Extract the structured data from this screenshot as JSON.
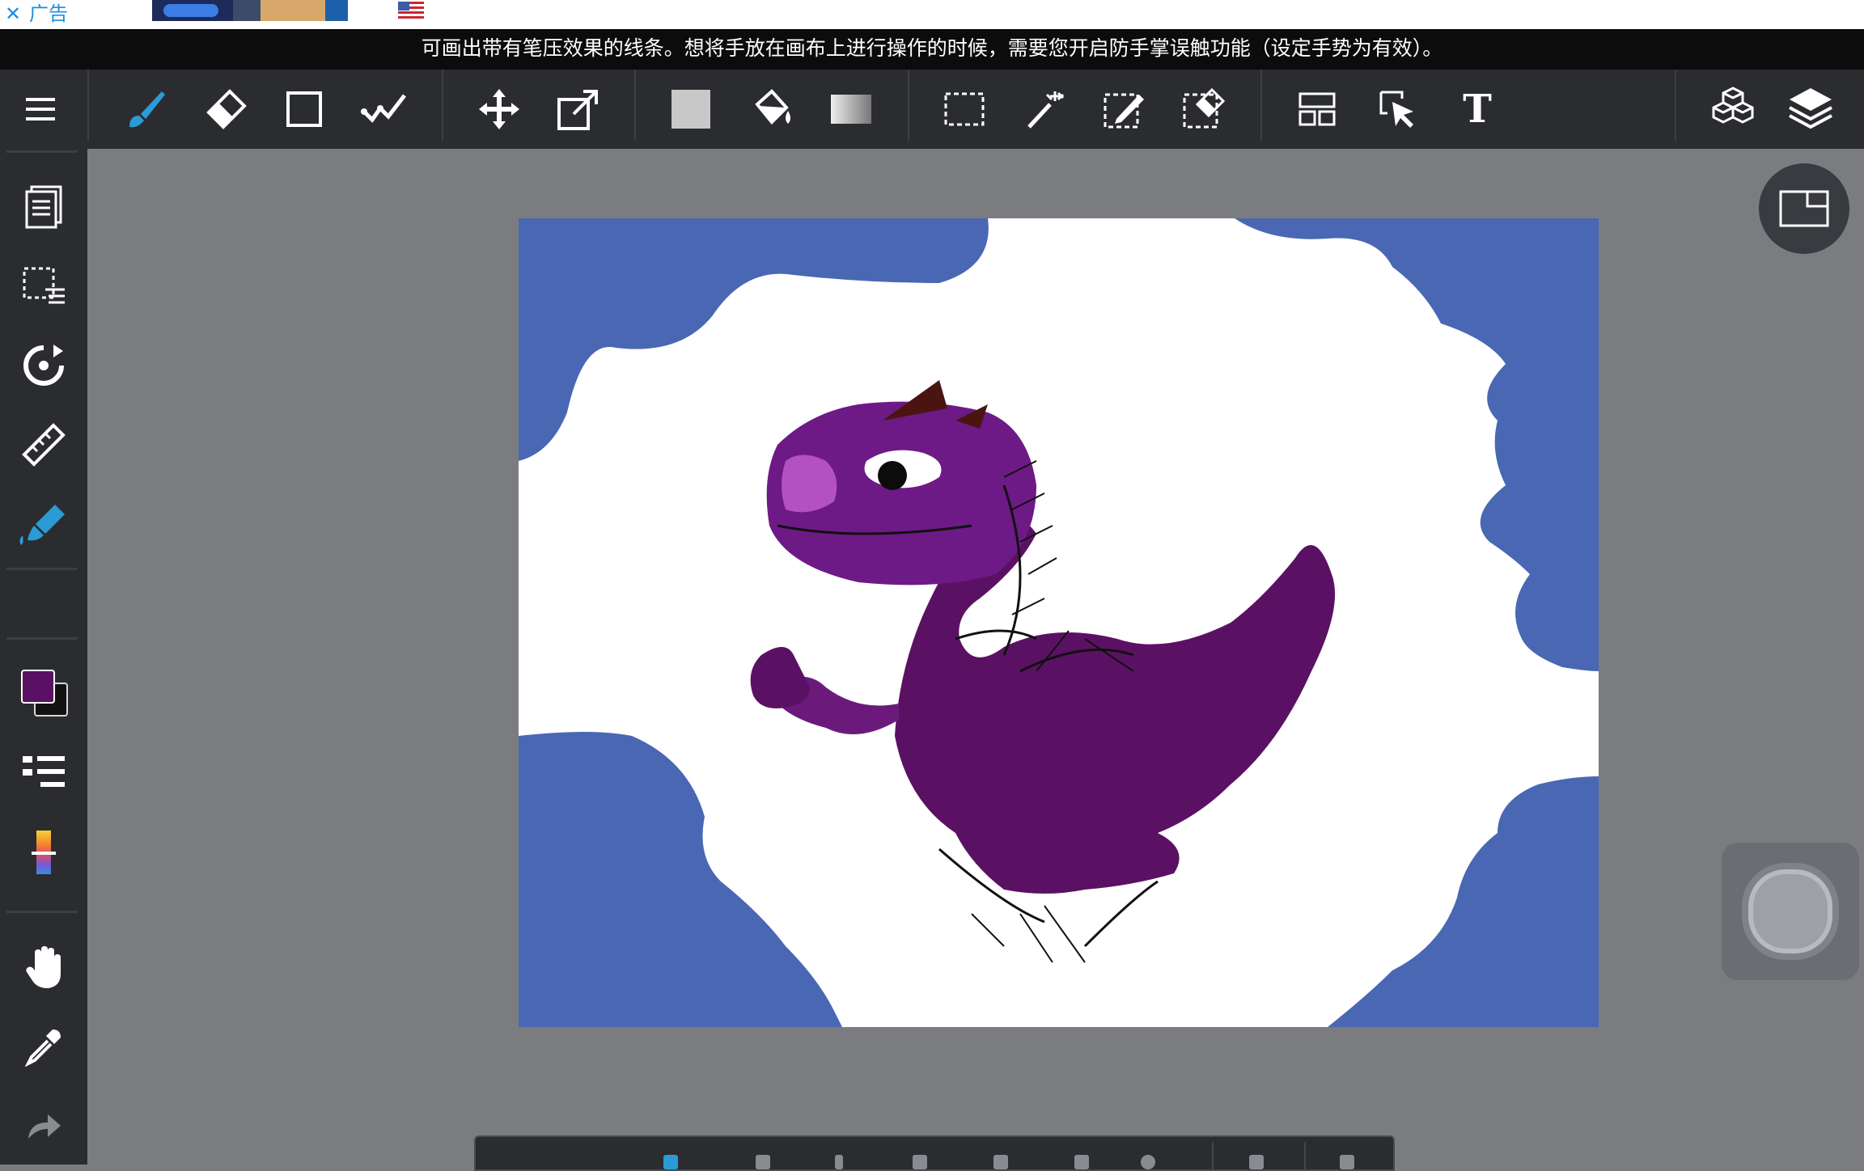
{
  "ad": {
    "close_glyph": "✕",
    "label": "广告"
  },
  "tip": {
    "text": "可画出带有笔压效果的线条。想将手放在画布上进行操作的时候，需要您开启防手掌误触功能（设定手势为有效）。"
  },
  "toolbar": {
    "tools": [
      "menu-icon",
      "brush-icon",
      "eraser-icon",
      "shape-icon",
      "correction-pen-icon",
      "move-icon",
      "transform-icon",
      "fill-color-icon",
      "bucket-icon",
      "gradient-icon",
      "select-rect-icon",
      "magic-wand-icon",
      "select-pen-icon",
      "select-eraser-icon",
      "layout-icon",
      "operation-icon",
      "text-icon",
      "3d-material-icon",
      "layers-icon"
    ],
    "text_tool_label": "T",
    "active_tool": "brush-icon"
  },
  "sidebar": {
    "tools": [
      "pages-icon",
      "selection-list-icon",
      "rotate-icon",
      "ruler-icon",
      "brush-fill-icon",
      "color-swatch",
      "brush-settings-icon",
      "color-picker-bar-icon",
      "hand-icon",
      "eyedropper-icon",
      "redo-icon"
    ],
    "active_tool": "brush-fill-icon"
  },
  "colors": {
    "accent": "#2a9bd5",
    "foreground": "#5b1163",
    "background": "#121212",
    "canvas_blue": "#4a67b4",
    "dragon_body": "#5b1163",
    "dragon_head": "#6d1a86",
    "dragon_nose": "#b44fc4",
    "horn": "#4a1410"
  },
  "canvas": {
    "subject": "purple-dragon-drawing"
  }
}
